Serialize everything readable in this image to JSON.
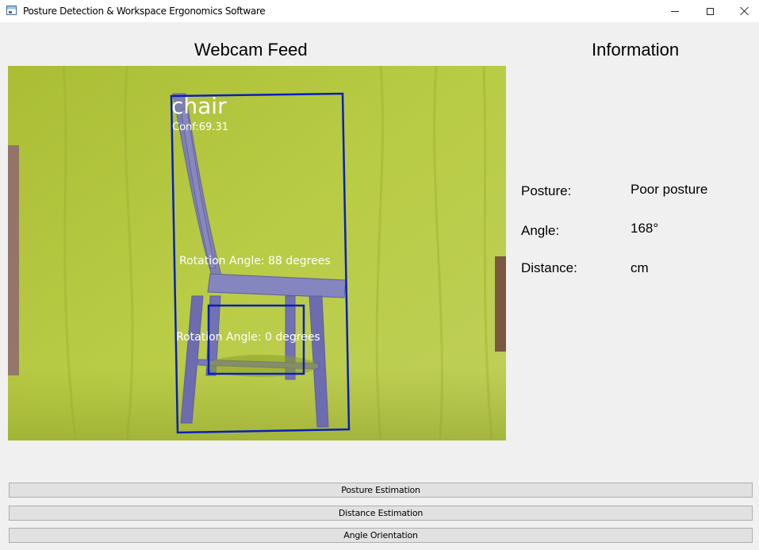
{
  "window": {
    "title": "Posture Detection & Workspace Ergonomics Software",
    "icon": "app-window-icon",
    "controls": {
      "minimize": "minimize-icon",
      "maximize": "maximize-icon",
      "close": "close-icon"
    }
  },
  "headings": {
    "webcam": "Webcam Feed",
    "info": "Information"
  },
  "feed": {
    "detection_label": "chair",
    "confidence_text": "Conf:69.31",
    "rotation_text_1": "Rotation Angle: 88 degrees",
    "rotation_text_2": "Rotation Angle: 0 degrees",
    "box_color": "#0a1fb8",
    "backdrop_color": "#b6c93a"
  },
  "info": {
    "posture_label": "Posture:",
    "posture_value": "Poor posture",
    "angle_label": "Angle:",
    "angle_value": "168°",
    "distance_label": "Distance:",
    "distance_value": "cm"
  },
  "buttons": {
    "posture": "Posture Estimation",
    "distance": "Distance Estimation",
    "angle": "Angle Orientation"
  }
}
